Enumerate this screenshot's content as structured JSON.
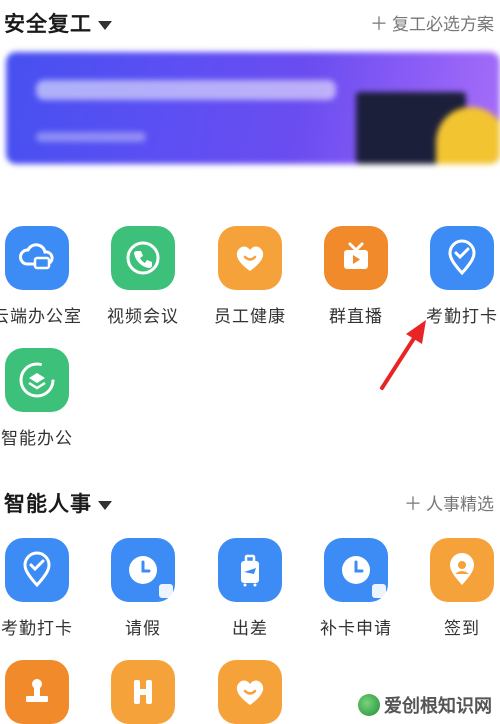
{
  "section1": {
    "title": "安全复工",
    "action": "复工必选方案"
  },
  "section1_items": [
    {
      "label": "云端办公室",
      "icon": "cloud-office-icon",
      "color": "#3d8bf5"
    },
    {
      "label": "视频会议",
      "icon": "video-call-icon",
      "color": "#3cc07a"
    },
    {
      "label": "员工健康",
      "icon": "heart-icon",
      "color": "#f6a23a"
    },
    {
      "label": "群直播",
      "icon": "live-tv-icon",
      "color": "#f08a2a"
    },
    {
      "label": "考勤打卡",
      "icon": "location-check-icon",
      "color": "#3d8bf5"
    },
    {
      "label": "智能办公",
      "icon": "smart-office-icon",
      "color": "#3cc07a"
    }
  ],
  "section2": {
    "title": "智能人事",
    "action": "人事精选"
  },
  "section2_items": [
    {
      "label": "考勤打卡",
      "icon": "location-check-icon",
      "color": "#3d8bf5"
    },
    {
      "label": "请假",
      "icon": "clock-icon",
      "color": "#3d8bf5"
    },
    {
      "label": "出差",
      "icon": "suitcase-icon",
      "color": "#3d8bf5"
    },
    {
      "label": "补卡申请",
      "icon": "clock-icon",
      "color": "#3d8bf5"
    },
    {
      "label": "签到",
      "icon": "location-pin-icon",
      "color": "#f6a23a"
    }
  ],
  "section2_partial_icons": [
    "stamp-icon",
    "h-letter-icon",
    "heart-icon"
  ],
  "watermark": {
    "text": "爱创根知识网"
  }
}
